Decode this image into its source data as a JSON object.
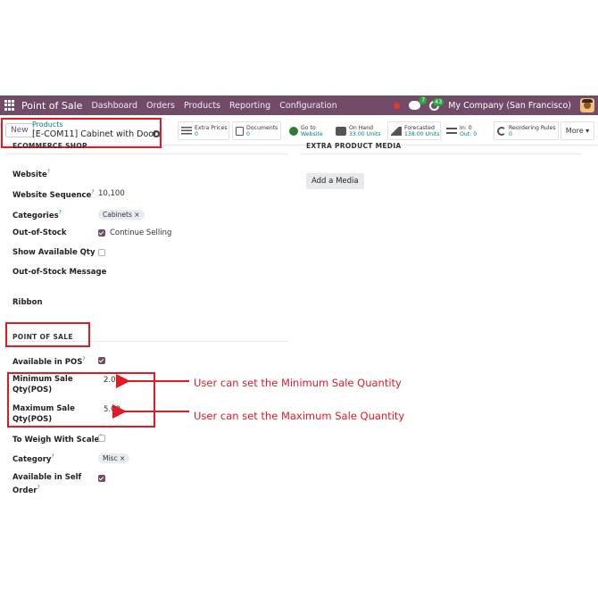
{
  "navbar": {
    "app_title": "Point of Sale",
    "menu": [
      "Dashboard",
      "Orders",
      "Products",
      "Reporting",
      "Configuration"
    ],
    "chat_count": "7",
    "activity_count": "43",
    "company": "My Company (San Francisco)"
  },
  "control_panel": {
    "new_label": "New",
    "breadcrumb_parent": "Products",
    "breadcrumb_current": "[E-COM11] Cabinet with Doors",
    "stats": [
      {
        "label": "Extra Prices",
        "value": "0"
      },
      {
        "label": "Documents",
        "value": "0"
      },
      {
        "label": "Go to",
        "value": "Website"
      },
      {
        "label": "On Hand",
        "value": "33.00 Units"
      },
      {
        "label": "Forecasted",
        "value": "138.00 Units"
      },
      {
        "label": "In: 0",
        "value": "Out: 0"
      },
      {
        "label": "Reordering Rules",
        "value": "0"
      }
    ],
    "more_label": "More ▾"
  },
  "left": {
    "cut_section": "ECOMMERCE SHOP",
    "website_label": "Website",
    "website_seq_label": "Website Sequence",
    "website_seq_value": "10,100",
    "categories_label": "Categories",
    "categories_tag": "Cabinets ×",
    "out_of_stock_label": "Out-of-Stock",
    "continue_selling": "Continue Selling",
    "show_qty_label": "Show Available Qty",
    "oos_message_label": "Out-of-Stock Message",
    "ribbon_label": "Ribbon",
    "pos_section": "POINT OF SALE",
    "available_pos_label": "Available in POS",
    "min_label_1": "Minimum Sale",
    "min_label_2": "Qty(POS)",
    "min_value": "2.00",
    "max_label_1": "Maximum Sale",
    "max_label_2": "Qty(POS)",
    "max_value": "5.00",
    "weigh_label": "To Weigh With Scale",
    "pos_category_label": "Category",
    "pos_category_tag": "Misc ×",
    "self_order_label_1": "Available in Self",
    "self_order_label_2": "Order"
  },
  "right": {
    "media_section": "EXTRA PRODUCT MEDIA",
    "add_media_label": "Add a Media"
  },
  "annotations": {
    "min_text": "User can set the Minimum Sale Quantity",
    "max_text": "User can set the Maximum Sale Quantity"
  },
  "colors": {
    "navbar": "#714b67",
    "accent": "#017e84",
    "highlight": "#e01b24"
  }
}
